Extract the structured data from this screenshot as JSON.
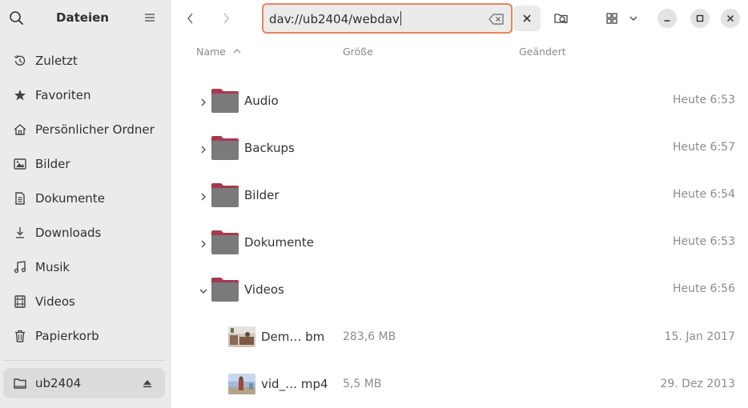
{
  "sidebar": {
    "title": "Dateien",
    "items": [
      {
        "label": "Zuletzt",
        "icon": "clock-icon"
      },
      {
        "label": "Favoriten",
        "icon": "star-icon"
      },
      {
        "label": "Persönlicher Ordner",
        "icon": "home-icon"
      },
      {
        "label": "Bilder",
        "icon": "image-icon"
      },
      {
        "label": "Dokumente",
        "icon": "document-icon"
      },
      {
        "label": "Downloads",
        "icon": "download-icon"
      },
      {
        "label": "Musik",
        "icon": "music-icon"
      },
      {
        "label": "Videos",
        "icon": "video-icon"
      },
      {
        "label": "Papierkorb",
        "icon": "trash-icon"
      }
    ],
    "mount": {
      "label": "ub2404",
      "icon": "drive-icon"
    }
  },
  "toolbar": {
    "location": "dav://ub2404/webdav"
  },
  "columns": {
    "name": "Name",
    "size": "Größe",
    "modified": "Geändert"
  },
  "rows": [
    {
      "name": "Audio",
      "type": "folder",
      "size": "",
      "date": "Heute 6:53",
      "expanded": false
    },
    {
      "name": "Backups",
      "type": "folder",
      "size": "",
      "date": "Heute 6:57",
      "expanded": false
    },
    {
      "name": "Bilder",
      "type": "folder",
      "size": "",
      "date": "Heute 6:54",
      "expanded": false
    },
    {
      "name": "Dokumente",
      "type": "folder",
      "size": "",
      "date": "Heute 6:53",
      "expanded": false
    },
    {
      "name": "Videos",
      "type": "folder",
      "size": "",
      "date": "Heute 6:56",
      "expanded": true
    },
    {
      "name": "Dem… bm",
      "type": "file",
      "size": "283,6 MB",
      "date": "15. Jan 2017"
    },
    {
      "name": "vid_… mp4",
      "type": "file",
      "size": "5,5 MB",
      "date": "29. Dez 2013"
    }
  ],
  "colors": {
    "accent": "#e8845b",
    "folder_body": "#7a7a7a",
    "folder_tab": "#a8384e"
  }
}
